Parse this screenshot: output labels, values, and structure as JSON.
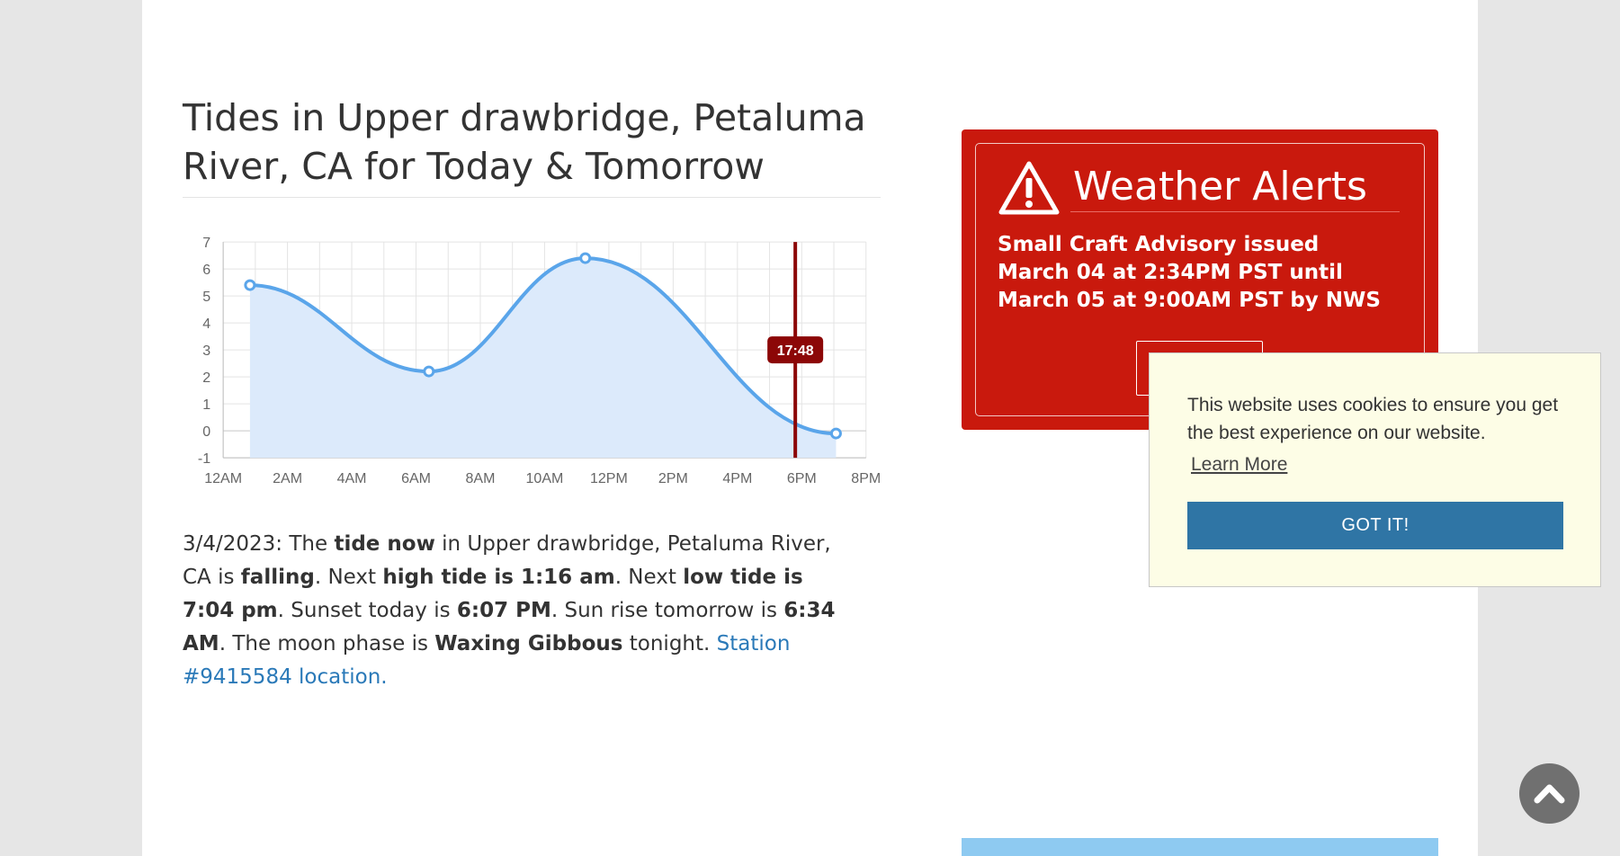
{
  "title": "Tides in Upper drawbridge, Petaluma River, CA for Today & Tomorrow",
  "chart_data": {
    "type": "area",
    "x_tick_labels": [
      "12AM",
      "2AM",
      "4AM",
      "6AM",
      "8AM",
      "10AM",
      "12PM",
      "2PM",
      "4PM",
      "6PM",
      "8PM"
    ],
    "y_tick_labels": [
      "7",
      "6",
      "5",
      "4",
      "3",
      "2",
      "1",
      "0",
      "-1"
    ],
    "xlim": [
      0,
      20
    ],
    "ylim": [
      -1,
      7
    ],
    "grid": true,
    "series": [
      {
        "x": [
          0.833,
          6.4,
          11.267,
          19.067
        ],
        "y": [
          5.4,
          2.2,
          6.4,
          -0.1
        ],
        "color": "#5aa5ea"
      }
    ],
    "now_marker": {
      "x": 17.8,
      "label": "17:48",
      "color": "#8c0707"
    }
  },
  "description": {
    "date_prefix": "3/4/2023: The ",
    "tide_now": "tide now",
    "t1": " in Upper drawbridge, Petaluma River, CA is ",
    "state": "falling",
    "t2": ". Next ",
    "high_tide": "high tide is 1:16 am",
    "t3": ". Next ",
    "low_tide": "low tide is 7:04 pm",
    "t4": ". Sunset today is ",
    "sunset": "6:07 PM",
    "t5": ". Sun rise tomorrow is ",
    "sunrise": "6:34 AM",
    "t6": ". The moon phase is ",
    "moon": "Waxing Gibbous",
    "t7": " tonight. ",
    "station_link": "Station #9415584 location."
  },
  "weather_alert": {
    "heading": "Weather Alerts",
    "text": "Small Craft Advisory issued March 04 at 2:34PM PST until March 05 at 9:00AM PST by NWS",
    "icon": "warning-triangle-icon"
  },
  "cookie_banner": {
    "message": "This website uses cookies to ensure you get the best experience on our website.",
    "learn_more": "Learn More",
    "button": "GOT IT!"
  },
  "scroll_top": {
    "icon": "chevron-up-icon"
  },
  "colors": {
    "alert_red": "#c9190d",
    "link_blue": "#2a79b8",
    "cookie_button": "#2f75a5",
    "cookie_bg": "#fdfde6",
    "series_line": "#5aa5ea",
    "now_marker": "#8c0707"
  }
}
